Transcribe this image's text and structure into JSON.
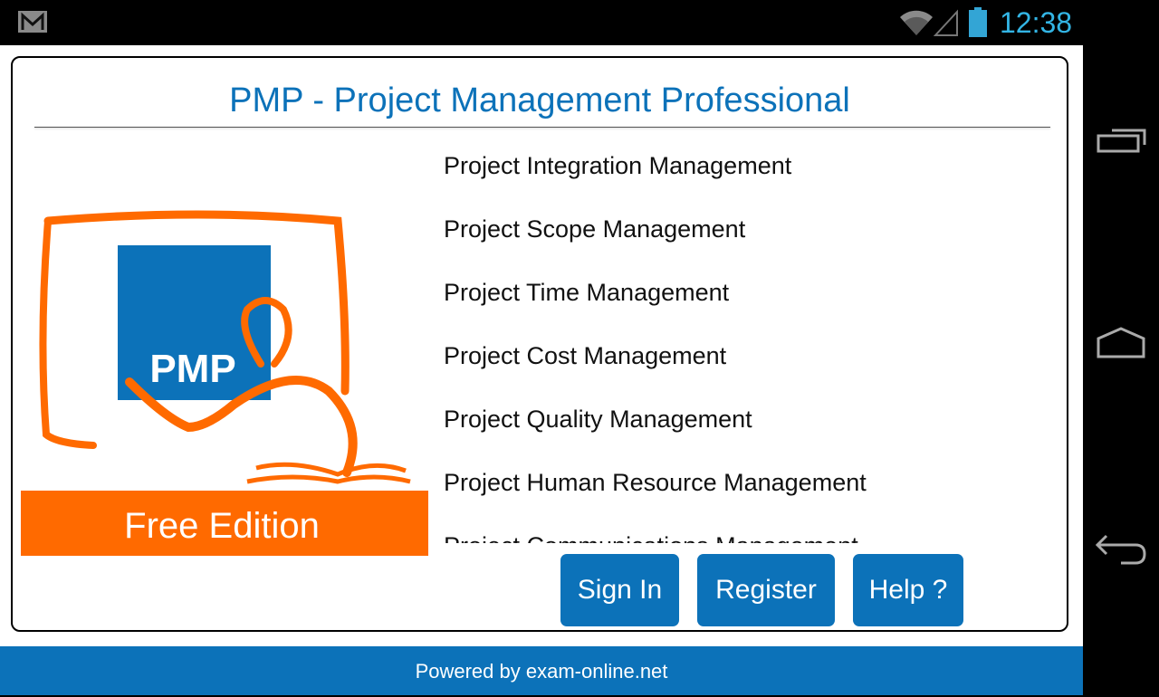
{
  "status_bar": {
    "time": "12:38",
    "icons": [
      "gmail-icon",
      "wifi-icon",
      "signal-icon",
      "battery-icon"
    ],
    "clock_color": "#33b5e5"
  },
  "app": {
    "title": "PMP - Project Management Professional",
    "logo": {
      "badge_text": "PMP",
      "edition_text": "Free Edition",
      "colors": {
        "blue": "#0c72b9",
        "orange": "#ff6a00"
      }
    },
    "topics": [
      "Project Integration Management",
      "Project Scope Management",
      "Project Time Management",
      "Project Cost Management",
      "Project Quality Management",
      "Project Human Resource Management",
      "Project Communications Management"
    ],
    "buttons": {
      "sign_in": "Sign In",
      "register": "Register",
      "help": "Help ?"
    },
    "footer": "Powered by exam-online.net",
    "accent_color": "#0c72b9"
  },
  "nav_bar": {
    "buttons": [
      "recent-apps",
      "home",
      "back"
    ]
  }
}
